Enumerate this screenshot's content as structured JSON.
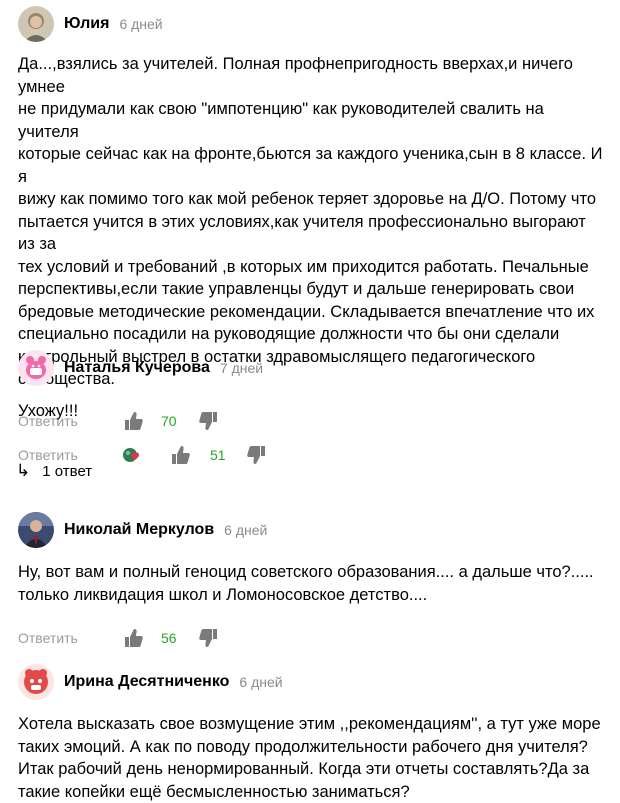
{
  "comments": [
    {
      "author": "Юлия",
      "time": "6 дней",
      "text": "Да...,взялись за учителей. Полная профнепригодность вверхах,и ничего умнее\nне придумали как свою \"импотенцию\" как руководителей свалить на учителя\nкоторые сейчас как на фронте,бьются за каждого ученика,сын в 8 классе. И я\nвижу как помимо того как мой ребенок теряет здоровье на Д/О. Потому что\nпытается учится в этих условиях,как учителя профессионально выгорают из за\nтех условий и требований ,в которых им приходится работать. Печальные\nперспективы,если такие управленцы будут и дальше генерировать свои\nбредовые методические рекомендации. Складывается впечатление что их\nспециально посадили на руководящие должности что бы они сделали\nконтрольный выстрел в остатки здравомыслящего педагогического\nсообщества.",
      "reply_label": "Ответить",
      "likes": "70"
    },
    {
      "author": "Наталья Кучерова",
      "time": "7 дней",
      "text": "Ухожу!!!",
      "reply_label": "Ответить",
      "likes": "51",
      "replies_label": "1 ответ"
    },
    {
      "author": "Николай Меркулов",
      "time": "6 дней",
      "text": "Ну, вот вам и полный геноцид советского образования.... а дальше что?.....\nтолько ликвидация школ и Ломоносовское детство....",
      "reply_label": "Ответить",
      "likes": "56"
    },
    {
      "author": "Ирина Десятниченко",
      "time": "6 дней",
      "text": "Хотела высказать свое возмущение этим ,,рекомендациям'', а тут уже море\nтаких эмоций. А как по поводу продолжительности рабочего дня учителя?\nИтак рабочий день ненормированный. Когда эти отчеты составлять?Да за\nтакие копейки ещё бесмысленностью заниматься?"
    }
  ],
  "colors": {
    "likes": "#2aa52a",
    "muted": "#9b9b9b",
    "time": "#8a8a8a"
  },
  "icons": {
    "like": "thumb-up-icon",
    "dislike": "thumb-down-icon",
    "reactions": "reactions-icon",
    "reply_arrow": "reply-arrow-icon"
  }
}
